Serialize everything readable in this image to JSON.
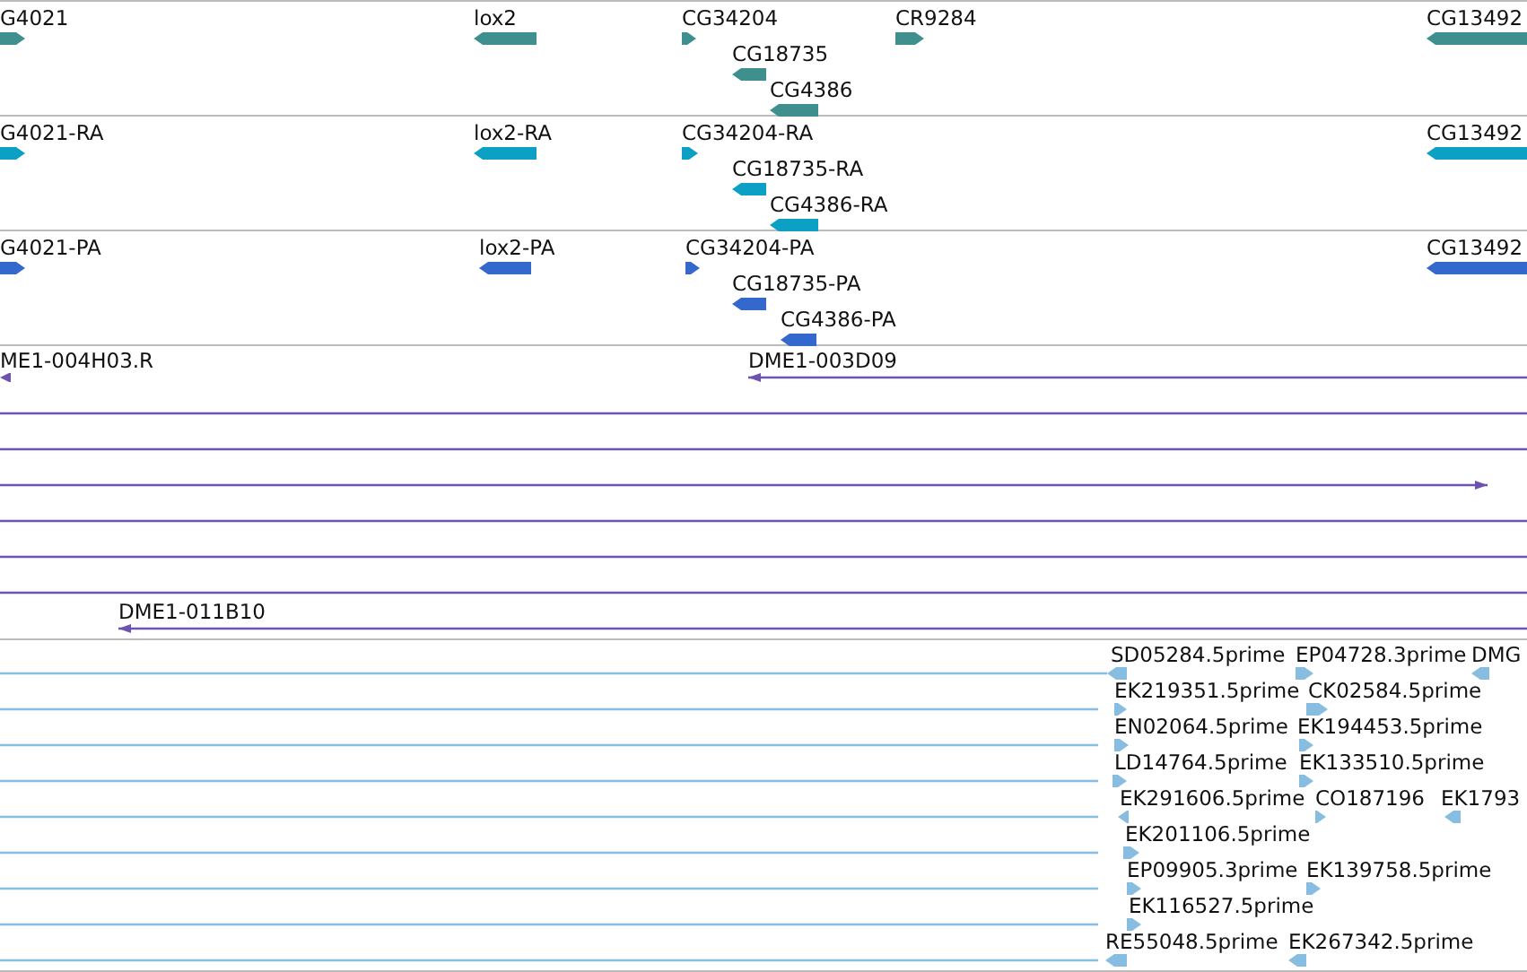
{
  "tracks": [
    {
      "kind": "gene",
      "rows": [
        [
          {
            "label": "G4021",
            "reverse": false
          },
          {
            "label": "lox2",
            "reverse": true
          },
          {
            "label": "CG34204",
            "reverse": false
          },
          {
            "label": "CR9284",
            "reverse": false
          },
          {
            "label": "CG13492",
            "reverse": true
          }
        ],
        [
          {
            "label": "CG18735",
            "reverse": true
          }
        ],
        [
          {
            "label": "CG4386",
            "reverse": true
          }
        ]
      ]
    },
    {
      "kind": "transcript",
      "rows": [
        [
          {
            "label": "G4021-RA",
            "reverse": false
          },
          {
            "label": "lox2-RA",
            "reverse": true
          },
          {
            "label": "CG34204-RA",
            "reverse": false
          },
          {
            "label": "CG13492",
            "reverse": true
          }
        ],
        [
          {
            "label": "CG18735-RA",
            "reverse": true
          }
        ],
        [
          {
            "label": "CG4386-RA",
            "reverse": true
          }
        ]
      ]
    },
    {
      "kind": "protein",
      "rows": [
        [
          {
            "label": "G4021-PA",
            "reverse": false
          },
          {
            "label": "lox2-PA",
            "reverse": true
          },
          {
            "label": "CG34204-PA",
            "reverse": false
          },
          {
            "label": "CG13492",
            "reverse": true
          }
        ],
        [
          {
            "label": "CG18735-PA",
            "reverse": true
          }
        ],
        [
          {
            "label": "CG4386-PA",
            "reverse": true
          }
        ]
      ]
    },
    {
      "kind": "clone",
      "rows": [
        [
          {
            "label": "ME1-004H03.R",
            "reverse": true
          },
          {
            "label": "DME1-003D09",
            "reverse": true
          }
        ],
        [
          {
            "label": "DME1-011B10",
            "reverse": true
          }
        ]
      ]
    },
    {
      "kind": "est",
      "rows": [
        [
          {
            "label": "SD05284.5prime",
            "reverse": true
          },
          {
            "label": "EP04728.3prime",
            "reverse": false
          },
          {
            "label": "DMG",
            "reverse": true
          }
        ],
        [
          {
            "label": "EK219351.5prime",
            "reverse": false
          },
          {
            "label": "CK02584.5prime",
            "reverse": false
          }
        ],
        [
          {
            "label": "EN02064.5prime",
            "reverse": false
          },
          {
            "label": "EK194453.5prime",
            "reverse": false
          }
        ],
        [
          {
            "label": "LD14764.5prime",
            "reverse": false
          },
          {
            "label": "EK133510.5prime",
            "reverse": false
          }
        ],
        [
          {
            "label": "EK291606.5prime",
            "reverse": true
          },
          {
            "label": "CO187196",
            "reverse": false
          },
          {
            "label": "EK1793",
            "reverse": true
          }
        ],
        [
          {
            "label": "EK201106.5prime",
            "reverse": false
          }
        ],
        [
          {
            "label": "EP09905.3prime",
            "reverse": false
          },
          {
            "label": "EK139758.5prime",
            "reverse": false
          }
        ],
        [
          {
            "label": "EK116527.5prime",
            "reverse": false
          }
        ],
        [
          {
            "label": "RE55048.5prime",
            "reverse": true
          },
          {
            "label": "EK267342.5prime",
            "reverse": true
          }
        ]
      ]
    }
  ]
}
